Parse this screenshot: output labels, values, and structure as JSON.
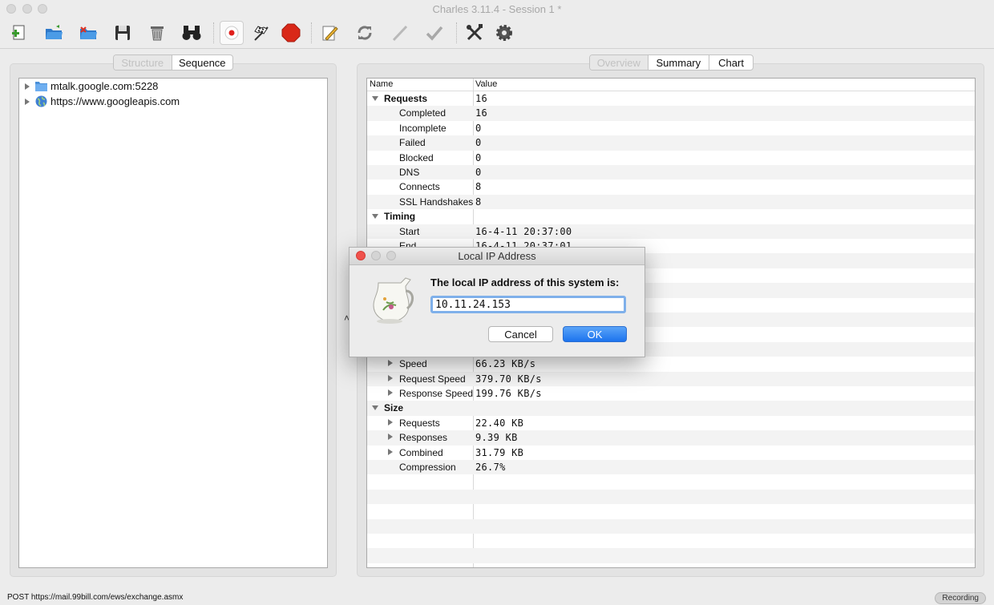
{
  "window": {
    "title": "Charles 3.11.4 - Session 1 *"
  },
  "toolbar": {
    "icons": [
      "new-session-icon",
      "open-folder-icon",
      "close-session-icon",
      "save-icon",
      "clear-session-icon",
      "find-binoculars-icon",
      "record-icon",
      "throttle-flag-icon",
      "stop-icon",
      "edit-pencil-icon",
      "repeat-icon",
      "disabled-pencil-icon",
      "validate-check-icon",
      "tools-icon",
      "settings-gear-icon"
    ]
  },
  "left_panel": {
    "tabs": [
      "Structure",
      "Sequence"
    ],
    "active_tab": "Sequence",
    "tree": [
      {
        "label": "mtalk.google.com:5228",
        "icon": "folder-icon"
      },
      {
        "label": "https://www.googleapis.com",
        "icon": "globe-icon"
      }
    ]
  },
  "right_panel": {
    "tabs": [
      "Overview",
      "Summary",
      "Chart"
    ],
    "active_tab": "Overview",
    "columns": {
      "name": "Name",
      "value": "Value"
    },
    "rows": [
      {
        "name": "Requests",
        "value": "16",
        "group": true
      },
      {
        "name": "Completed",
        "value": "16"
      },
      {
        "name": "Incomplete",
        "value": "0"
      },
      {
        "name": "Failed",
        "value": "0"
      },
      {
        "name": "Blocked",
        "value": "0"
      },
      {
        "name": "DNS",
        "value": "0"
      },
      {
        "name": "Connects",
        "value": "8"
      },
      {
        "name": "SSL Handshakes",
        "value": "8"
      },
      {
        "name": "Timing",
        "value": "",
        "group": true
      },
      {
        "name": "Start",
        "value": "16-4-11 20:37:00"
      },
      {
        "name": "End",
        "value": "16-4-11 20:37:01"
      },
      {
        "name": "",
        "value": ""
      },
      {
        "name": "",
        "value": ""
      },
      {
        "name": "",
        "value": ""
      },
      {
        "name": "",
        "value": ""
      },
      {
        "name": "",
        "value": ""
      },
      {
        "name": "",
        "value": ""
      },
      {
        "name": "",
        "value": ""
      },
      {
        "name": "Speed",
        "value": "66.23 KB/s",
        "expandable": true
      },
      {
        "name": "Request Speed",
        "value": "379.70 KB/s",
        "expandable": true
      },
      {
        "name": "Response Speed",
        "value": "199.76 KB/s",
        "expandable": true
      },
      {
        "name": "Size",
        "value": "",
        "group": true
      },
      {
        "name": "Requests",
        "value": "22.40 KB",
        "expandable": true
      },
      {
        "name": "Responses",
        "value": "9.39 KB",
        "expandable": true
      },
      {
        "name": "Combined",
        "value": "31.79 KB",
        "expandable": true
      },
      {
        "name": "Compression",
        "value": "26.7%"
      }
    ]
  },
  "status": {
    "left": "POST https://mail.99bill.com/ews/exchange.asmx",
    "recording": "Recording"
  },
  "dialog": {
    "title": "Local IP Address",
    "message": "The local IP address of this system is:",
    "ip_value": "10.11.24.153",
    "cancel_label": "Cancel",
    "ok_label": "OK",
    "icon": "pitcher-icon",
    "accent_color": "#1c73ee"
  }
}
